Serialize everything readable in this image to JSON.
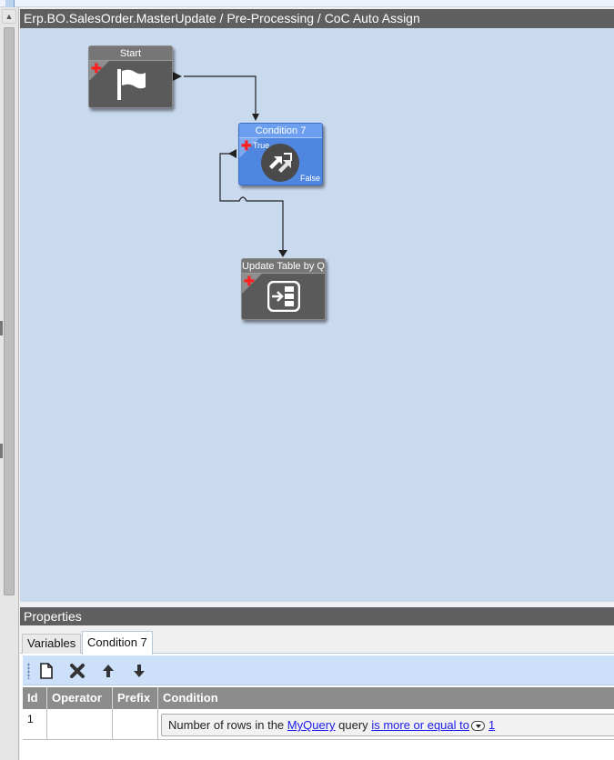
{
  "breadcrumb": "Erp.BO.SalesOrder.MasterUpdate / Pre-Processing / CoC Auto Assign",
  "nodes": {
    "start": {
      "title": "Start",
      "icon": "flag-icon"
    },
    "condition": {
      "title": "Condition 7",
      "icon": "condition-arrows-icon",
      "true_label": "True",
      "false_label": "False"
    },
    "update": {
      "title": "Update Table by Q",
      "icon": "update-table-icon"
    }
  },
  "properties": {
    "title": "Properties",
    "tabs": [
      {
        "label": "Variables"
      },
      {
        "label": "Condition 7",
        "active": true
      }
    ],
    "toolbar": [
      "new-icon",
      "delete-icon",
      "move-up-icon",
      "move-down-icon"
    ],
    "grid": {
      "columns": [
        "Id",
        "Operator",
        "Prefix",
        "Condition"
      ],
      "rows": [
        {
          "id": "1",
          "operator": "",
          "prefix": "",
          "condition": {
            "text1": "Number of rows in the",
            "link1": "MyQuery",
            "text2": "query",
            "link2": "is more or equal to",
            "link3": "1"
          }
        }
      ]
    }
  },
  "colors": {
    "canvas": "#c9d9ee",
    "node_dark": "#5a5a5a",
    "node_selected": "#4f86e0",
    "header_bar": "#5f5f5f",
    "link": "#1a1aee"
  }
}
